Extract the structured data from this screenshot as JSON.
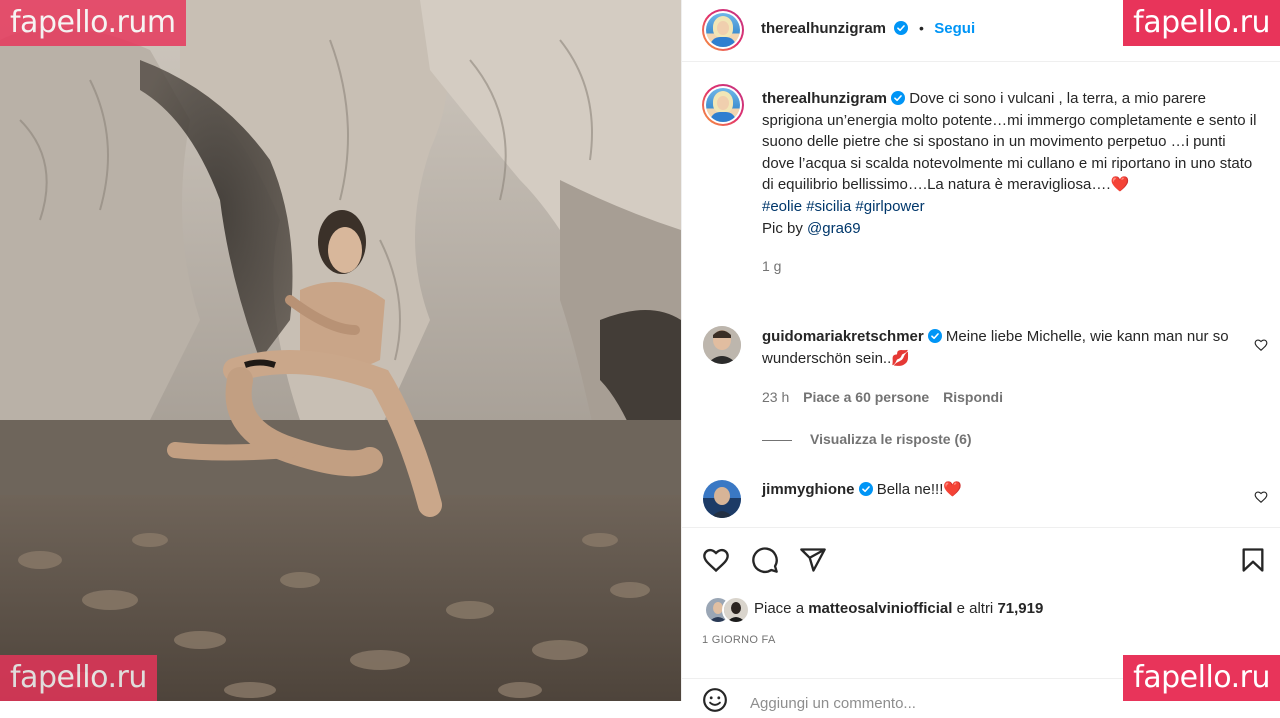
{
  "watermarks": {
    "top_left": "fapello.rum",
    "top_right": "fapello.ru",
    "bottom_left": "fapello.ru",
    "bottom_right": "fapello.ru",
    "color": "#e8345a"
  },
  "post": {
    "author": "therealhunzigram",
    "follow_label": "Segui",
    "separator": "•",
    "caption": "Dove ci sono i vulcani , la terra, a mio parere sprigiona un’energia molto potente…mi immergo completamente e sento il suono delle pietre che si spostano in un movimento perpetuo …i punti dove l’acqua si scalda notevolmente mi cullano e mi riportano in uno stato di equilibrio bellissimo….La natura è meravigliosa….",
    "caption_emoji": "❤️",
    "hashtags": [
      "#eolie",
      "#sicilia",
      "#girlpower"
    ],
    "pic_by_prefix": "Pic by ",
    "pic_by_user": "@gra69",
    "age": "1 g"
  },
  "comments": [
    {
      "user": "guidomariakretschmer",
      "text": "Meine liebe Michelle, wie kann man nur so wunderschön sein..",
      "emoji": "💋",
      "time": "23 h",
      "likes": "Piace a 60 persone",
      "reply_label": "Rispondi",
      "view_replies": "Visualizza le risposte (6)"
    },
    {
      "user": "jimmyghione",
      "text": "Bella ne!!!",
      "emoji": "❤️"
    }
  ],
  "actions": {
    "icons": [
      "heart-icon",
      "comment-icon",
      "share-icon",
      "save-icon"
    ],
    "likes_prefix": "Piace a ",
    "likes_user": "matteosalviniofficial",
    "likes_suffix": " e altri ",
    "likes_count": "71,919",
    "time_ago": "1 GIORNO FA",
    "add_comment_placeholder": "Aggiungi un commento..."
  },
  "colors": {
    "link_blue": "#0095f6",
    "hashtag": "#00376b",
    "verified": "#0095f6",
    "muted": "#737373",
    "heart_red": "#e0245e"
  }
}
